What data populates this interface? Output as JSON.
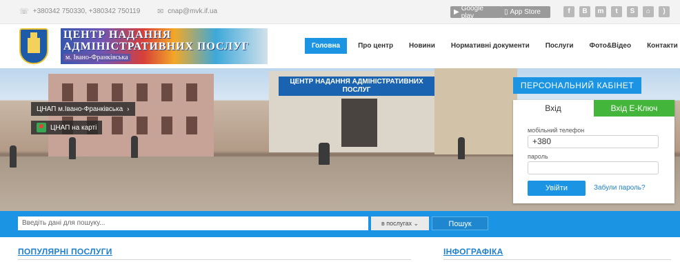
{
  "topbar": {
    "phones": "+380342 750330, +380342 750119",
    "email": "cnap@mvk.if.ua",
    "google_play": "Google play",
    "app_store": "App Store",
    "socials": [
      "facebook-icon",
      "blogger-icon",
      "myspace-icon",
      "twitter-icon",
      "skype-icon",
      "sitemap-icon",
      "rss-icon"
    ]
  },
  "header": {
    "logo_line1": "ЦЕНТР НАДАННЯ",
    "logo_line2": "АДМІНІСТРАТИВНИХ ПОСЛУГ",
    "logo_line3": "м. Івано-Франківська",
    "nav": [
      "Головна",
      "Про центр",
      "Новини",
      "Нормативні документи",
      "Послуги",
      "Фото&Відео",
      "Контакти"
    ]
  },
  "hero": {
    "sign": "ЦЕНТР НАДАННЯ АДМІНІСТРАТИВНИХ ПОСЛУГ",
    "link1": "ЦНАП м.Івано-Франківська",
    "link2": "ЦНАП на карті"
  },
  "cabinet": {
    "title": "ПЕРСОНАЛЬНИЙ КАБІНЕТ",
    "tab_login": "Вхід",
    "tab_ekey": "Вхід Е-Ключ",
    "phone_label": "мобільний телефон",
    "phone_value": "+380",
    "password_label": "пароль",
    "login_button": "Увійти",
    "forgot": "Забули пароль?"
  },
  "search": {
    "placeholder": "Введіть дані для пошуку...",
    "scope": "в послугах",
    "button": "Пошук"
  },
  "sections": {
    "popular": "ПОПУЛЯРНІ ПОСЛУГИ",
    "infographics": "ІНФОГРАФІКА"
  },
  "colors": {
    "accent": "#1b95e3",
    "green": "#43b53a",
    "topbar": "#f3f3f3"
  }
}
